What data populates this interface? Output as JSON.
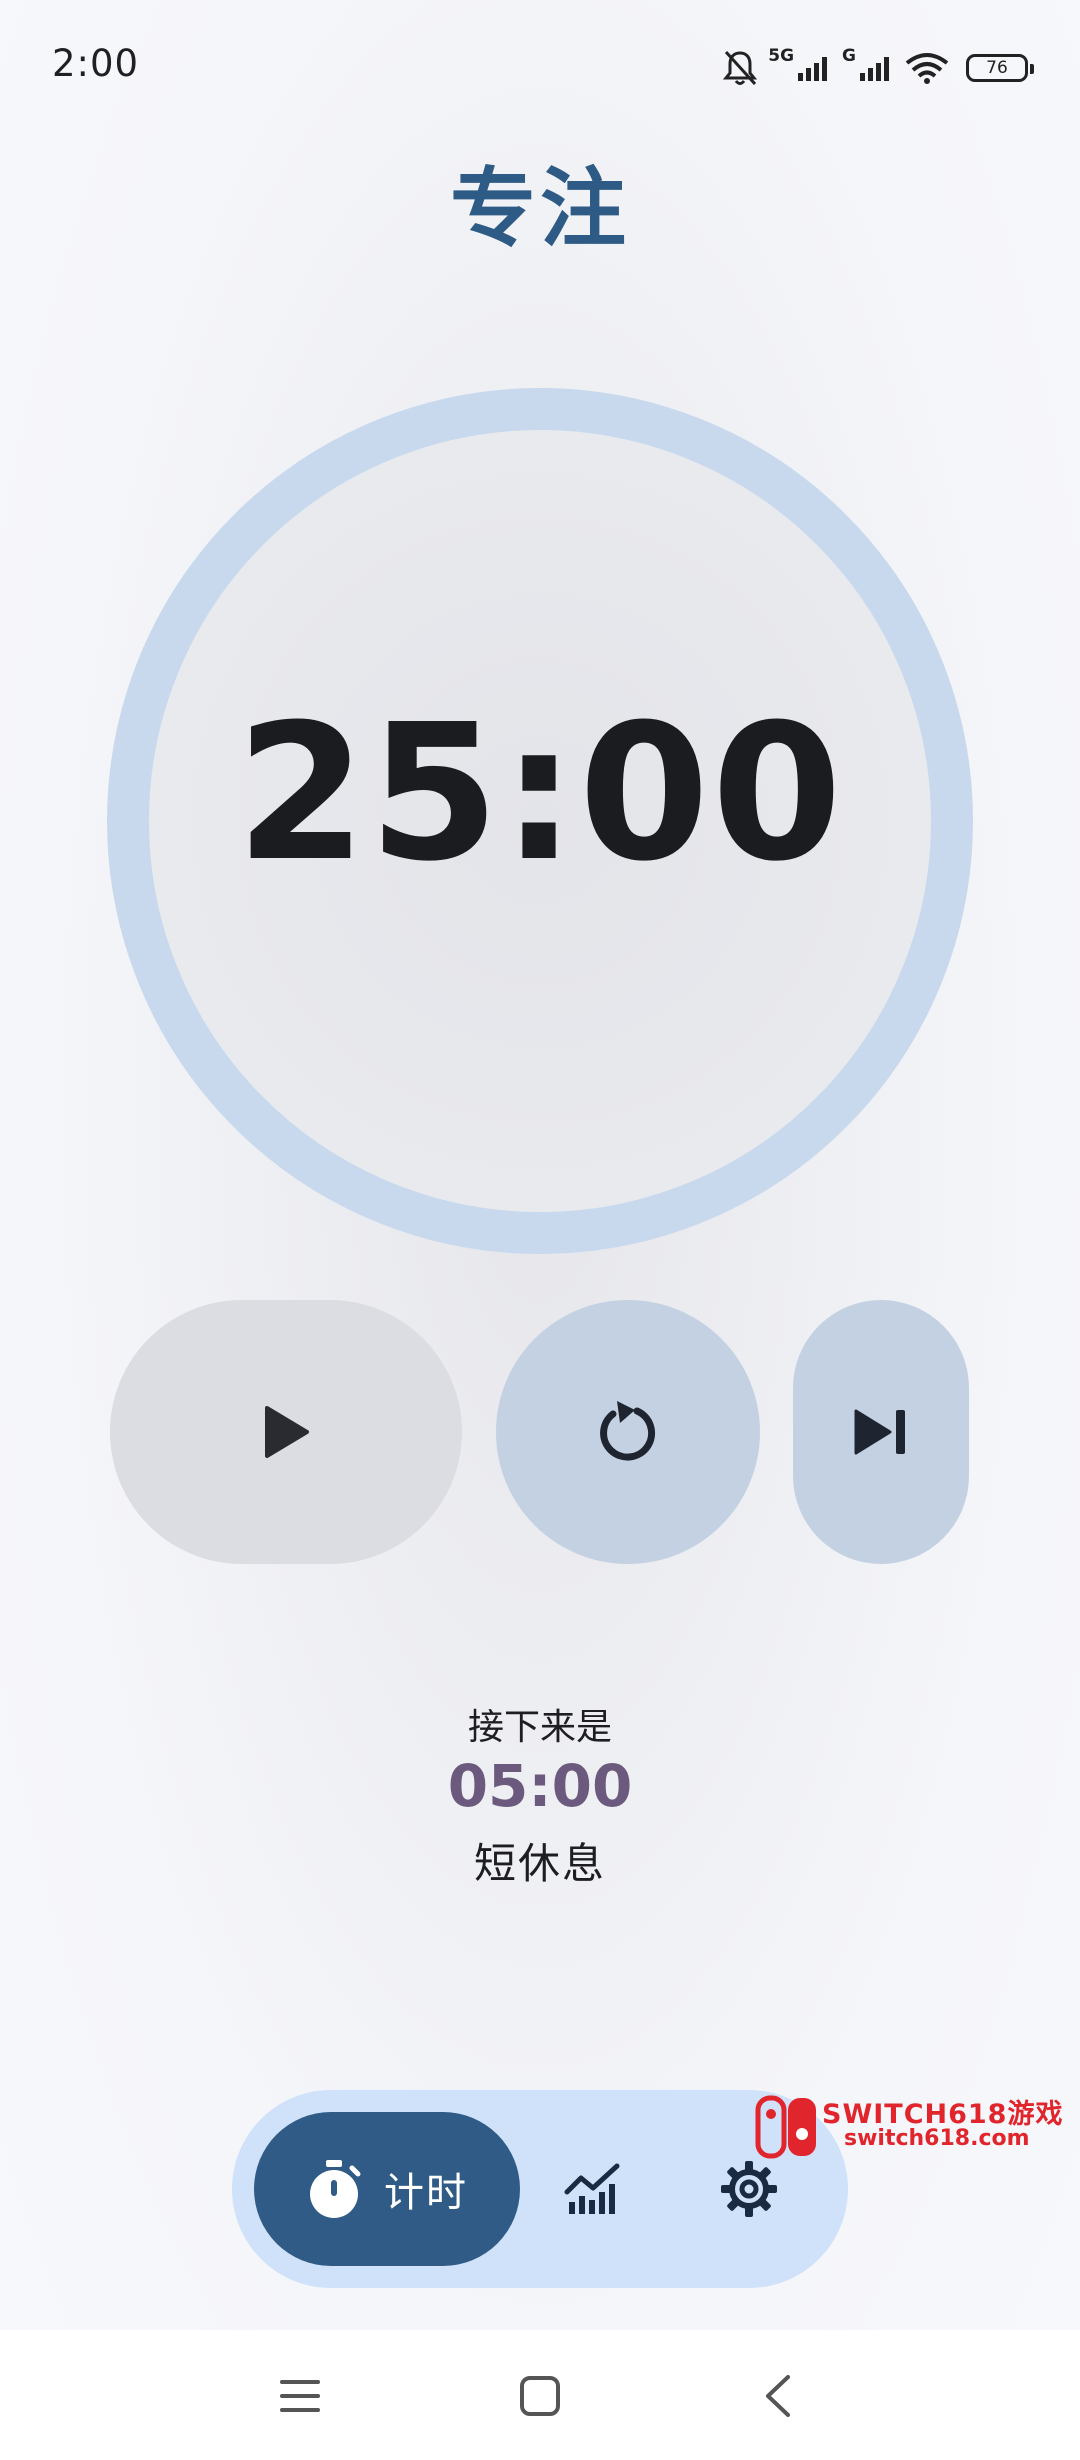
{
  "status_bar": {
    "time": "2:00",
    "network_1": "5G",
    "network_2": "G",
    "battery_level": "76",
    "icons": [
      "bell-muted-icon",
      "signal-icon",
      "signal-icon",
      "wifi-icon",
      "battery-icon"
    ]
  },
  "title": "专注",
  "timer": {
    "display": "25:00"
  },
  "controls": {
    "play_icon": "play-icon",
    "reset_icon": "reset-icon",
    "skip_icon": "skip-next-icon"
  },
  "next": {
    "label": "接下来是",
    "time": "05:00",
    "name": "短休息"
  },
  "bottom_nav": {
    "items": [
      {
        "label": "计时",
        "icon": "timer-icon",
        "active": true
      },
      {
        "label": "",
        "icon": "stats-icon",
        "active": false
      },
      {
        "label": "",
        "icon": "settings-icon",
        "active": false
      }
    ]
  },
  "watermark": {
    "title": "SWITCH618游戏",
    "subtitle": "switch618.com"
  },
  "system_nav": {
    "icons": [
      "menu-icon",
      "home-icon",
      "back-icon"
    ]
  },
  "colors": {
    "title": "#2e5b85",
    "ring": "#c8d9ee",
    "next_time": "#6b5a7d",
    "nav_bg": "#cfe2fa",
    "nav_active": "#2f5b86",
    "watermark": "#e0262c"
  }
}
